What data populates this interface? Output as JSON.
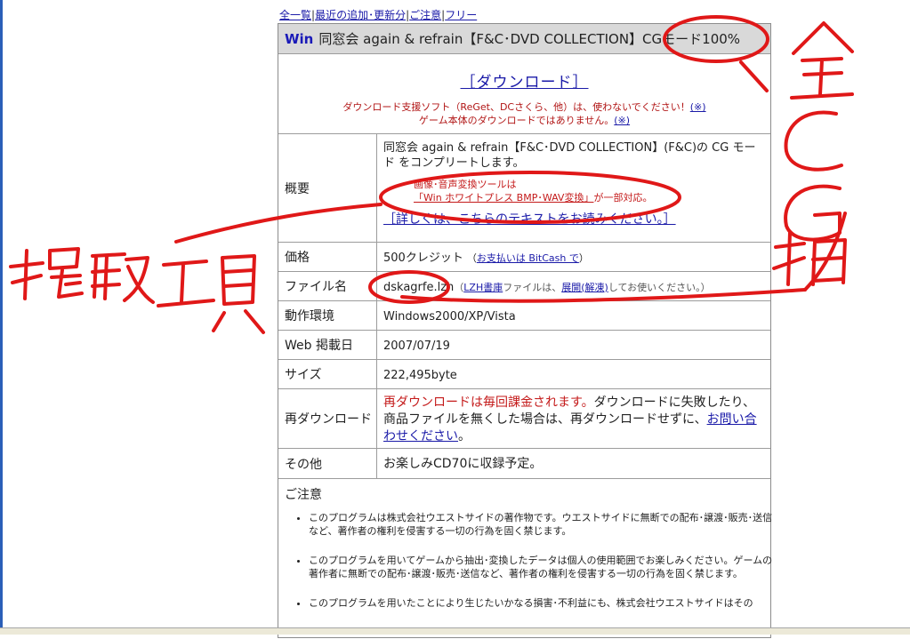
{
  "nav": {
    "links": [
      "全一覧",
      "最近の追加･更新分",
      "ご注意",
      "フリー"
    ],
    "separator": "|"
  },
  "product": {
    "title_prefix": "Win",
    "title": "同窓会 again & refrain【F&C･DVD COLLECTION】CGモード100%"
  },
  "download": {
    "link": "［ダウンロード］",
    "note1_text": "ダウンロード支援ソフト（ReGet、DCさくら、他）は、使わないでください！",
    "note_link": "(※)",
    "note2_text": "ゲーム本体のダウンロードではありません。"
  },
  "rows": {
    "overview": {
      "label": "概要",
      "description": "同窓会 again & refrain【F&C･DVD COLLECTION】(F&C)の CG モード をコンプリートします。",
      "tool_line1": "画像･音声変換ツールは",
      "tool_link": "「Win ホワイトプレス BMP･WAV変換」",
      "tool_suffix": "が一部対応。",
      "details_link": "［詳しくは、こちらのテキストをお読みください。］"
    },
    "price": {
      "label": "価格",
      "value": "500クレジット",
      "pay_link": "お支払いは BitCash で"
    },
    "file": {
      "label": "ファイル名",
      "value": "dskagrfe.lzh",
      "lzh_link": "LZH書庫",
      "text_mid": "ファイルは、",
      "expand_link": "展開(解凍)",
      "text_end": "してお使いください。"
    },
    "env": {
      "label": "動作環境",
      "value": "Windows2000/XP/Vista"
    },
    "date": {
      "label": "Web 掲載日",
      "value": "2007/07/19"
    },
    "size": {
      "label": "サイズ",
      "value": "222,495byte"
    },
    "redownload": {
      "label": "再ダウンロード",
      "red_text": "再ダウンロードは毎回課金されます。",
      "text": "ダウンロードに失敗したり、商品ファイルを無くした場合は、再ダウンロードせずに、",
      "contact_link": "お問い合わせください",
      "end": "。"
    },
    "other": {
      "label": "その他",
      "value": "お楽しみCD70に収録予定。"
    }
  },
  "notice": {
    "title": "ご注意",
    "items": [
      "このプログラムは株式会社ウエストサイドの著作物です。ウエストサイドに無断での配布･譲渡･販売･送信など、著作者の権利を侵害する一切の行為を固く禁じます。",
      "このプログラムを用いてゲームから抽出･変換したデータは個人の使用範囲でお楽しみください。ゲームの著作者に無断での配布･譲渡･販売･送信など、著作者の権利を侵害する一切の行為を固く禁じます。",
      "このプログラムを用いたことにより生じたいかなる損害･不利益にも、株式会社ウエストサイドはその"
    ]
  },
  "colors": {
    "annotation": "#e01818",
    "link": "#1a1aa8",
    "warning": "#c41a1a",
    "title_bg": "#d9d9d9"
  }
}
